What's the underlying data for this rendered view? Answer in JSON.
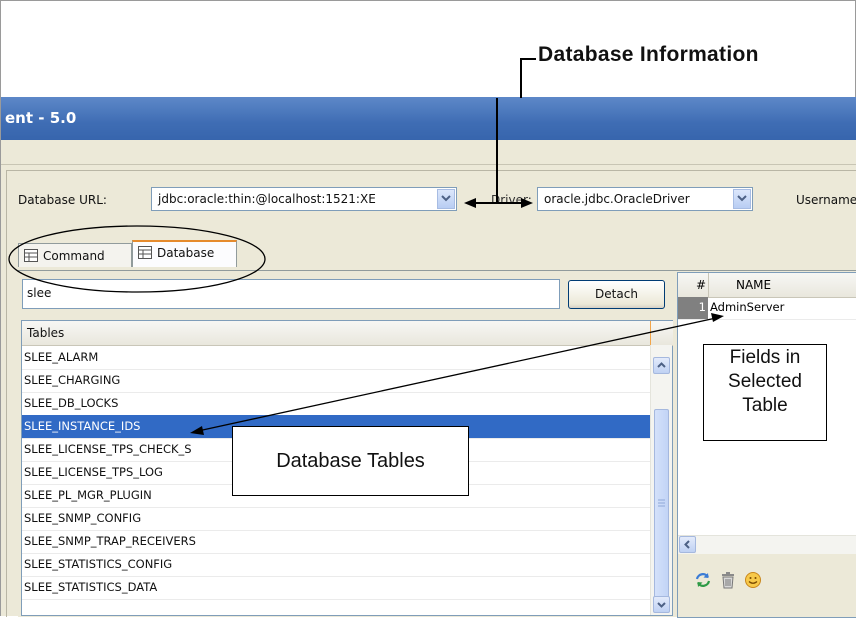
{
  "annotations": {
    "database_information": "Database Information",
    "fields_in_selected_table": [
      "Fields in",
      "Selected",
      "Table"
    ],
    "database_tables": "Database Tables"
  },
  "window": {
    "title": "ent - 5.0"
  },
  "connection": {
    "database_url_label": "Database URL:",
    "database_url_value": "jdbc:oracle:thin:@localhost:1521:XE",
    "driver_label": "Driver:",
    "driver_value": "oracle.jdbc.OracleDriver",
    "username_label": "Username"
  },
  "tabs": [
    {
      "label": "Command",
      "active": false
    },
    {
      "label": "Database",
      "active": true
    }
  ],
  "filter": {
    "value": "slee",
    "detach_label": "Detach"
  },
  "tables_panel": {
    "header": "Tables",
    "rows": [
      "SLEE_ALARM",
      "SLEE_CHARGING",
      "SLEE_DB_LOCKS",
      "SLEE_INSTANCE_IDS",
      "SLEE_LICENSE_TPS_CHECK_S",
      "SLEE_LICENSE_TPS_LOG",
      "SLEE_PL_MGR_PLUGIN",
      "SLEE_SNMP_CONFIG",
      "SLEE_SNMP_TRAP_RECEIVERS",
      "SLEE_STATISTICS_CONFIG",
      "SLEE_STATISTICS_DATA"
    ],
    "selected_index": 3
  },
  "fields_panel": {
    "col_number": "#",
    "col_name": "NAME",
    "rows": [
      {
        "num": "1",
        "name": "AdminServer"
      }
    ]
  },
  "icons": {
    "refresh": "refresh-icon",
    "delete": "trash-icon",
    "smiley": "smiley-icon",
    "tab": "table-icon",
    "dropdown": "chevron-down-icon"
  },
  "colors": {
    "titlebar": "#3f6db4",
    "selection": "#316ac5",
    "active_tab_accent": "#e68b2c",
    "panel_bg": "#ece9d8"
  }
}
